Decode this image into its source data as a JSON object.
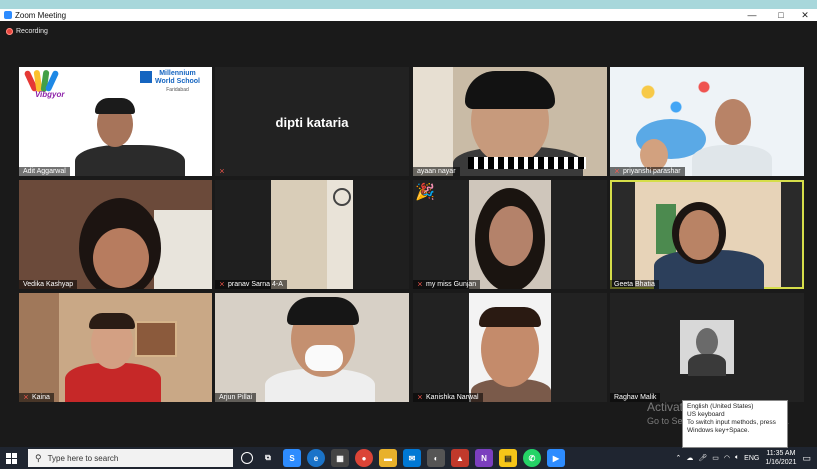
{
  "window": {
    "title": "Zoom Meeting",
    "controls": {
      "minimize": "—",
      "maximize": "□",
      "close": "✕"
    }
  },
  "recording": {
    "label": "Recording"
  },
  "participants": [
    {
      "name": "Adit Aggarwal",
      "muted": false
    },
    {
      "name": "dipti kataria",
      "muted": true
    },
    {
      "name": "ayaan nayar",
      "muted": false
    },
    {
      "name": "priyanshi parashar",
      "muted": true
    },
    {
      "name": "Vedika Kashyap",
      "muted": false
    },
    {
      "name": "pranav Sarna 4-A",
      "muted": true
    },
    {
      "name": "my miss Gunjan",
      "muted": true
    },
    {
      "name": "Geeta Bhatia",
      "muted": false
    },
    {
      "name": "Kaina",
      "muted": true
    },
    {
      "name": "Arjun Pillai",
      "muted": false
    },
    {
      "name": "Kanishka Narwal",
      "muted": true
    },
    {
      "name": "Raghav Malik",
      "muted": false
    }
  ],
  "school_logo": {
    "line1": "Millennium",
    "line2": "World School",
    "line3": "Faridabad",
    "brand": "Vibgyor"
  },
  "watermark": {
    "line1": "Activate Windows",
    "line2": "Go to Settings to activate Windows."
  },
  "keyboard_popup": {
    "line1": "English (United States)",
    "line2": "US keyboard",
    "line3": "To switch input methods, press",
    "line4": "Windows key+Space."
  },
  "taskbar": {
    "search_placeholder": "Type here to search",
    "language": "ENG",
    "time": "11:35 AM",
    "date": "1/16/2021"
  },
  "colors": {
    "active_speaker": "#d6de4a",
    "taskbar": "#1f2530",
    "meeting_bg": "#1a1a1a"
  }
}
